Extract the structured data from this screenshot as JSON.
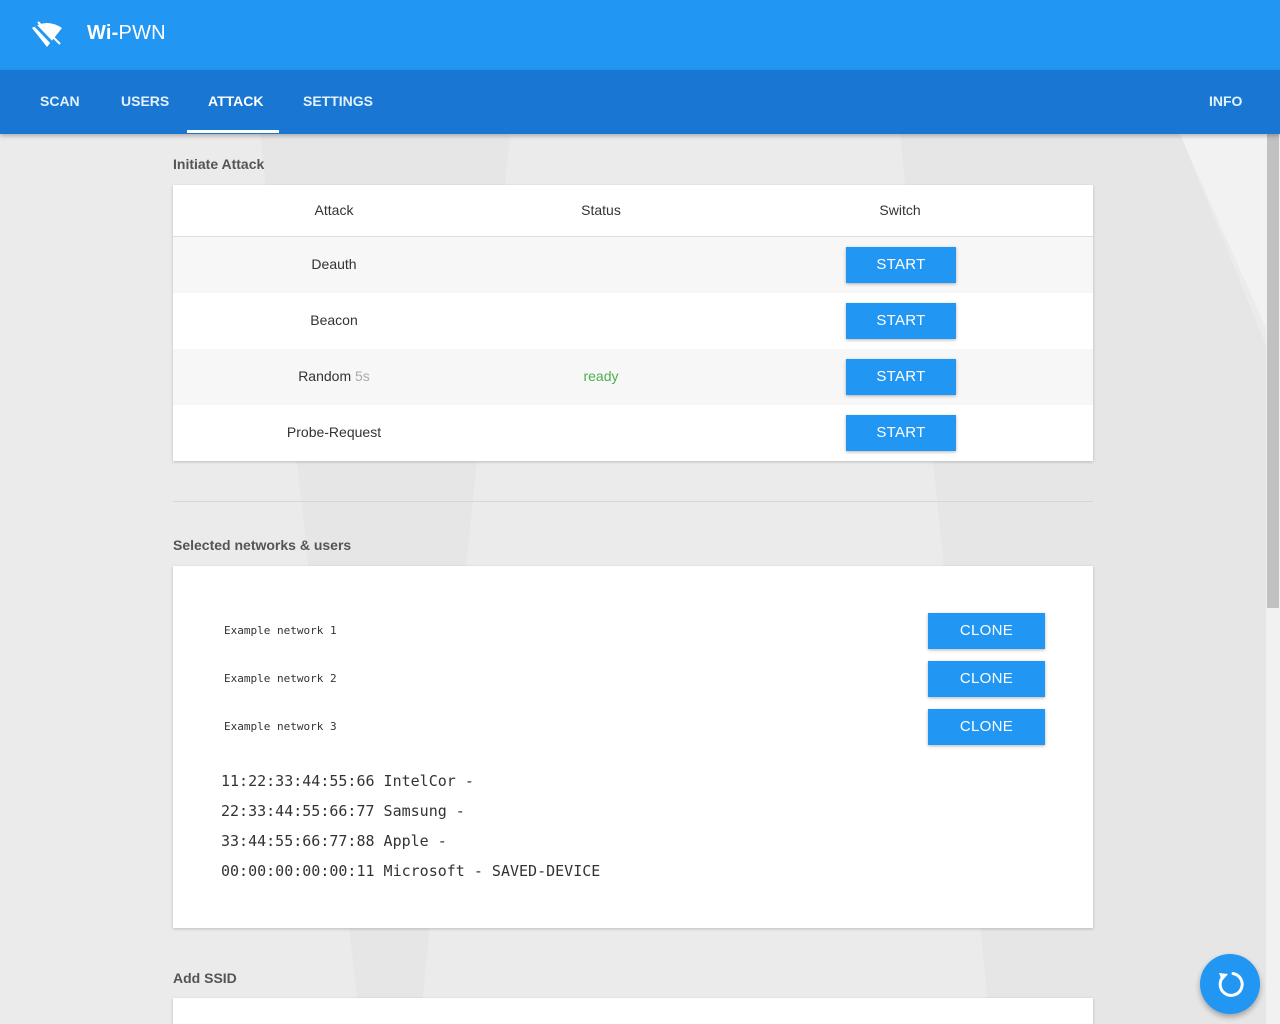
{
  "header": {
    "title_bold": "Wi-",
    "title_rest": "PWN",
    "logo_icon": "wifi-off-icon",
    "accent": "#2196f3",
    "nav_color": "#1976d2"
  },
  "nav": {
    "items": [
      {
        "label": "SCAN",
        "active": false
      },
      {
        "label": "USERS",
        "active": false
      },
      {
        "label": "ATTACK",
        "active": true
      },
      {
        "label": "SETTINGS",
        "active": false
      }
    ],
    "info_label": "INFO"
  },
  "attack": {
    "section_title": "Initiate Attack",
    "headers": {
      "attack": "Attack",
      "status": "Status",
      "switch": "Switch"
    },
    "rows": [
      {
        "name": "Deauth",
        "sub": "",
        "status": "",
        "button": "START"
      },
      {
        "name": "Beacon",
        "sub": "",
        "status": "",
        "button": "START"
      },
      {
        "name": "Random",
        "sub": "5s",
        "status": "ready",
        "button": "START"
      },
      {
        "name": "Probe-Request",
        "sub": "",
        "status": "",
        "button": "START"
      }
    ],
    "status_color": "#4caf50"
  },
  "selected": {
    "section_title": "Selected networks & users",
    "networks": [
      {
        "name": "Example network 1",
        "button": "CLONE"
      },
      {
        "name": "Example network 2",
        "button": "CLONE"
      },
      {
        "name": "Example network 3",
        "button": "CLONE"
      }
    ],
    "clients": [
      "11:22:33:44:55:66 IntelCor -",
      "22:33:44:55:66:77 Samsung -",
      "33:44:55:66:77:88 Apple -",
      "00:00:00:00:00:11 Microsoft - SAVED-DEVICE"
    ]
  },
  "add_ssid": {
    "section_title": "Add SSID"
  },
  "fab": {
    "icon": "refresh-icon"
  }
}
